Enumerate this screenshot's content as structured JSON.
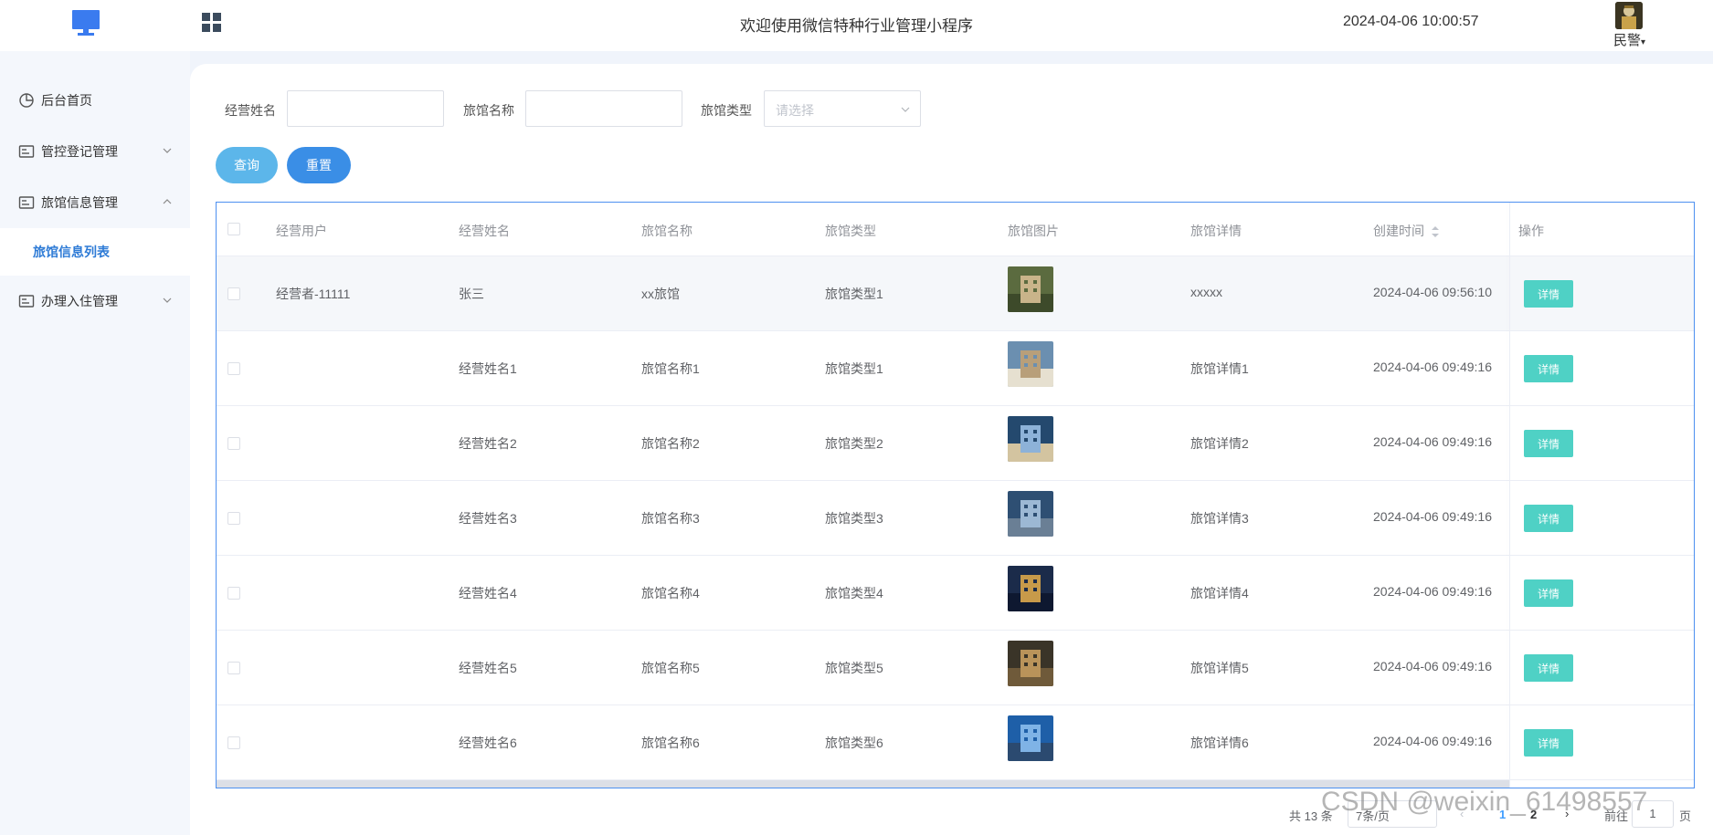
{
  "header": {
    "title": "欢迎使用微信特种行业管理小程序",
    "datetime": "2024-04-06 10:00:57",
    "user": "民警"
  },
  "sidebar": {
    "items": [
      {
        "label": "后台首页"
      },
      {
        "label": "管控登记管理"
      },
      {
        "label": "旅馆信息管理"
      },
      {
        "label": "办理入住管理"
      }
    ],
    "active_sub": "旅馆信息列表"
  },
  "filters": {
    "owner_name_label": "经营姓名",
    "hotel_name_label": "旅馆名称",
    "hotel_type_label": "旅馆类型",
    "hotel_type_placeholder": "请选择",
    "query_label": "查询",
    "reset_label": "重置"
  },
  "table": {
    "columns": [
      "经营用户",
      "经营姓名",
      "旅馆名称",
      "旅馆类型",
      "旅馆图片",
      "旅馆详情",
      "创建时间",
      "操作"
    ],
    "detail_label": "详情",
    "rows": [
      {
        "user": "经营者-11111",
        "name": "张三",
        "hotel": "xx旅馆",
        "type": "旅馆类型1",
        "detail": "xxxxx",
        "created": "2024-04-06 09:56:10"
      },
      {
        "user": "",
        "name": "经营姓名1",
        "hotel": "旅馆名称1",
        "type": "旅馆类型1",
        "detail": "旅馆详情1",
        "created": "2024-04-06 09:49:16"
      },
      {
        "user": "",
        "name": "经营姓名2",
        "hotel": "旅馆名称2",
        "type": "旅馆类型2",
        "detail": "旅馆详情2",
        "created": "2024-04-06 09:49:16"
      },
      {
        "user": "",
        "name": "经营姓名3",
        "hotel": "旅馆名称3",
        "type": "旅馆类型3",
        "detail": "旅馆详情3",
        "created": "2024-04-06 09:49:16"
      },
      {
        "user": "",
        "name": "经营姓名4",
        "hotel": "旅馆名称4",
        "type": "旅馆类型4",
        "detail": "旅馆详情4",
        "created": "2024-04-06 09:49:16"
      },
      {
        "user": "",
        "name": "经营姓名5",
        "hotel": "旅馆名称5",
        "type": "旅馆类型5",
        "detail": "旅馆详情5",
        "created": "2024-04-06 09:49:16"
      },
      {
        "user": "",
        "name": "经营姓名6",
        "hotel": "旅馆名称6",
        "type": "旅馆类型6",
        "detail": "旅馆详情6",
        "created": "2024-04-06 09:49:16"
      }
    ]
  },
  "pagination": {
    "total": "共 13 条",
    "page_size": "7条/页",
    "pages": [
      "1",
      "2"
    ],
    "goto_label": "前往",
    "goto_value": "1",
    "page_suffix": "页"
  },
  "watermark": "CSDN @weixin_61498557",
  "colors": {
    "accent": "#409eff",
    "detail_button": "#4fd1c5",
    "query_button": "#5cb6ea",
    "reset_button": "#3a8ee6"
  }
}
